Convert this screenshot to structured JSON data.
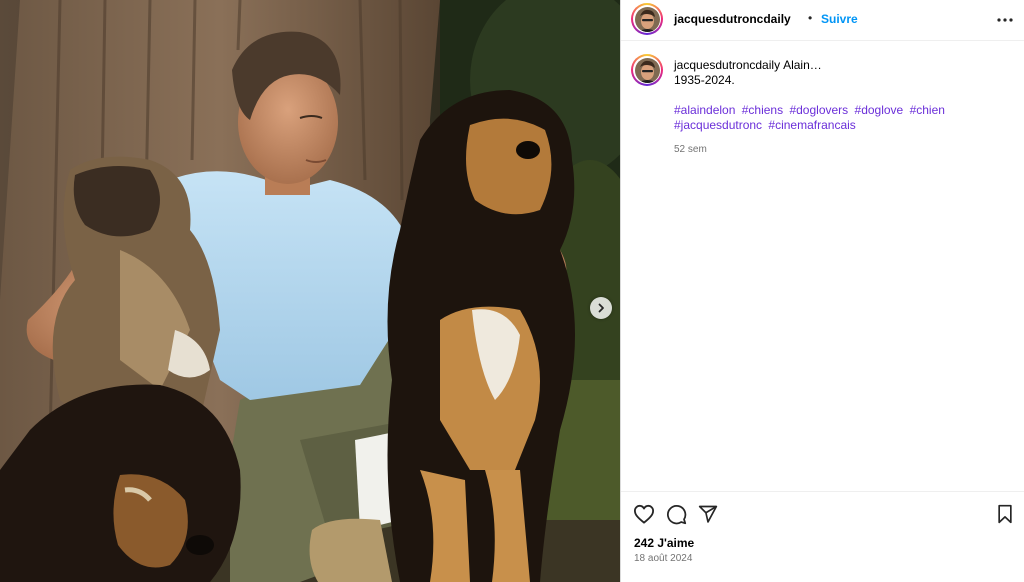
{
  "post": {
    "author": {
      "username": "jacquesdutroncdaily",
      "separator": "•",
      "follow_label": "Suivre",
      "more_icon": "more-horizontal-icon"
    },
    "caption": {
      "username": "jacquesdutroncdaily",
      "line1": "Alain…",
      "line2": "1935-2024.",
      "hashtags": [
        "#alaindelon",
        "#chiens",
        "#doglovers",
        "#doglove",
        "#chien",
        "#jacquesdutronc",
        "#cinemafrancais"
      ],
      "time_ago": "52 sem"
    },
    "actions": {
      "like_icon": "heart-icon",
      "comment_icon": "comment-icon",
      "share_icon": "share-icon",
      "save_icon": "bookmark-icon"
    },
    "likes": "242 J'aime",
    "date": "18 août 2024",
    "media": {
      "next_icon": "chevron-right-icon"
    },
    "colors": {
      "accent_blue": "#0095f6",
      "hashtag": "#6b2fd9",
      "muted": "#737373"
    }
  }
}
